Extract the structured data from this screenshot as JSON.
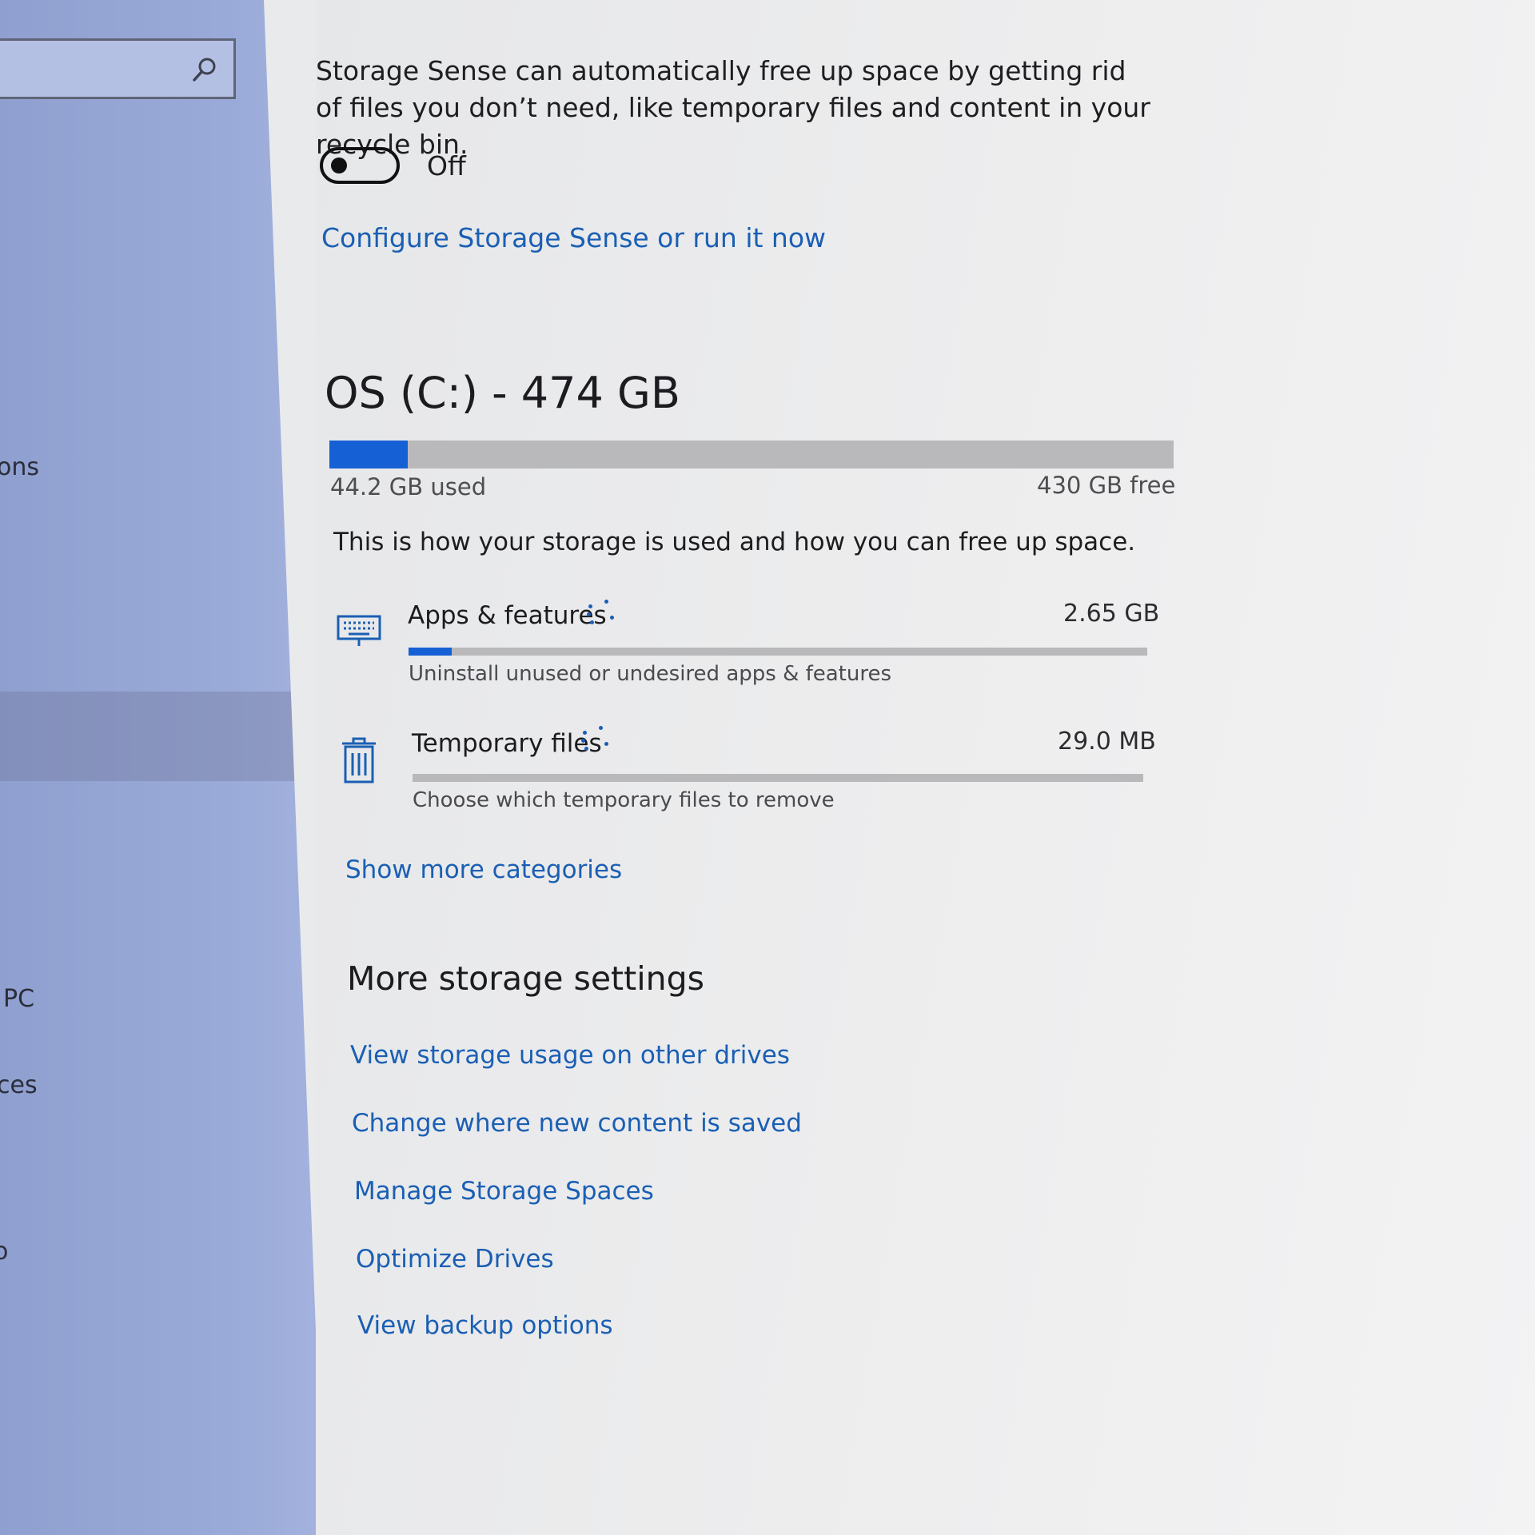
{
  "sidebar": {
    "search": {
      "placeholder": ""
    },
    "partial_items": [
      "ons",
      "PC",
      "ces",
      "o"
    ]
  },
  "storage_sense": {
    "description": "Storage Sense can automatically free up space by getting rid of files you don’t need, like temporary files and content in your recycle bin.",
    "toggle_state": "Off",
    "toggle_on": false,
    "configure_link": "Configure Storage Sense or run it now"
  },
  "drive": {
    "title": "OS (C:) - 474 GB",
    "used_label": "44.2 GB used",
    "free_label": "430 GB free",
    "used_fraction": 0.093,
    "intro": "This is how your storage is used and how you can free up space."
  },
  "categories": [
    {
      "name": "Apps & features",
      "size": "2.65 GB",
      "sub": "Uninstall unused or undesired apps & features",
      "fraction": 0.058,
      "icon": "keyboard-icon"
    },
    {
      "name": "Temporary files",
      "size": "29.0 MB",
      "sub": "Choose which temporary files to remove",
      "fraction": 0.0,
      "icon": "trash-icon"
    }
  ],
  "show_more": "Show more categories",
  "more_settings": {
    "title": "More storage settings",
    "links": [
      "View storage usage on other drives",
      "Change where new content is saved",
      "Manage Storage Spaces",
      "Optimize Drives",
      "View backup options"
    ]
  },
  "colors": {
    "accent": "#1660d6",
    "link": "#1a5fb4",
    "sidebar": "#9aaad8"
  }
}
